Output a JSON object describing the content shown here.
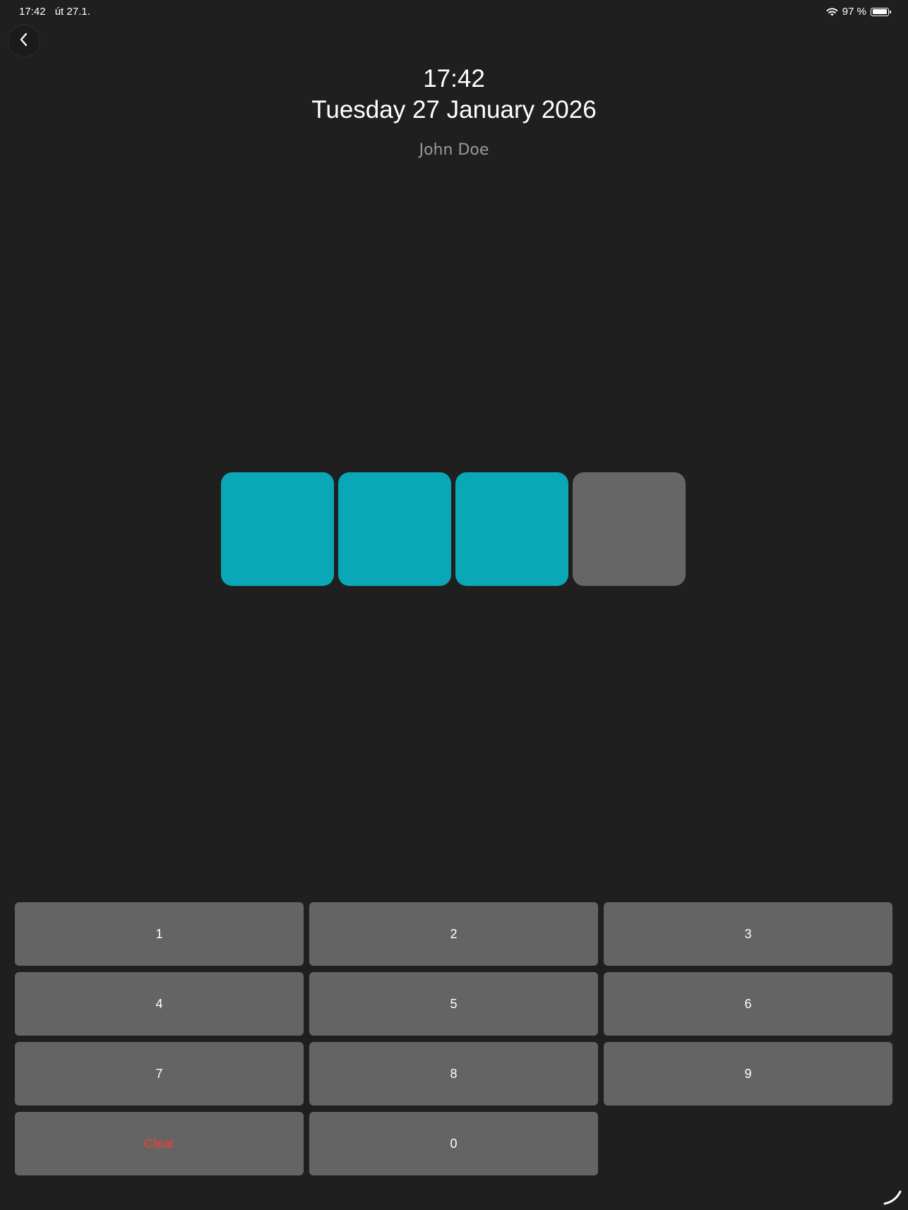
{
  "status_bar": {
    "time": "17:42",
    "date": "út 27.1.",
    "battery_percent": "97 %",
    "battery_level": 0.97,
    "icons": [
      "wifi-icon",
      "battery-icon"
    ]
  },
  "header": {
    "time": "17:42",
    "date": "Tuesday 27 January 2026",
    "user_name": "John Doe"
  },
  "pin": {
    "length": 4,
    "filled": 3
  },
  "keypad": {
    "keys": [
      "1",
      "2",
      "3",
      "4",
      "5",
      "6",
      "7",
      "8",
      "9",
      "Clear",
      "0"
    ]
  },
  "colors": {
    "background": "#1f1f1f",
    "pin_filled": "#0aa8b7",
    "pin_empty": "#666666",
    "key": "#646464",
    "clear_text": "#ff3b30"
  }
}
